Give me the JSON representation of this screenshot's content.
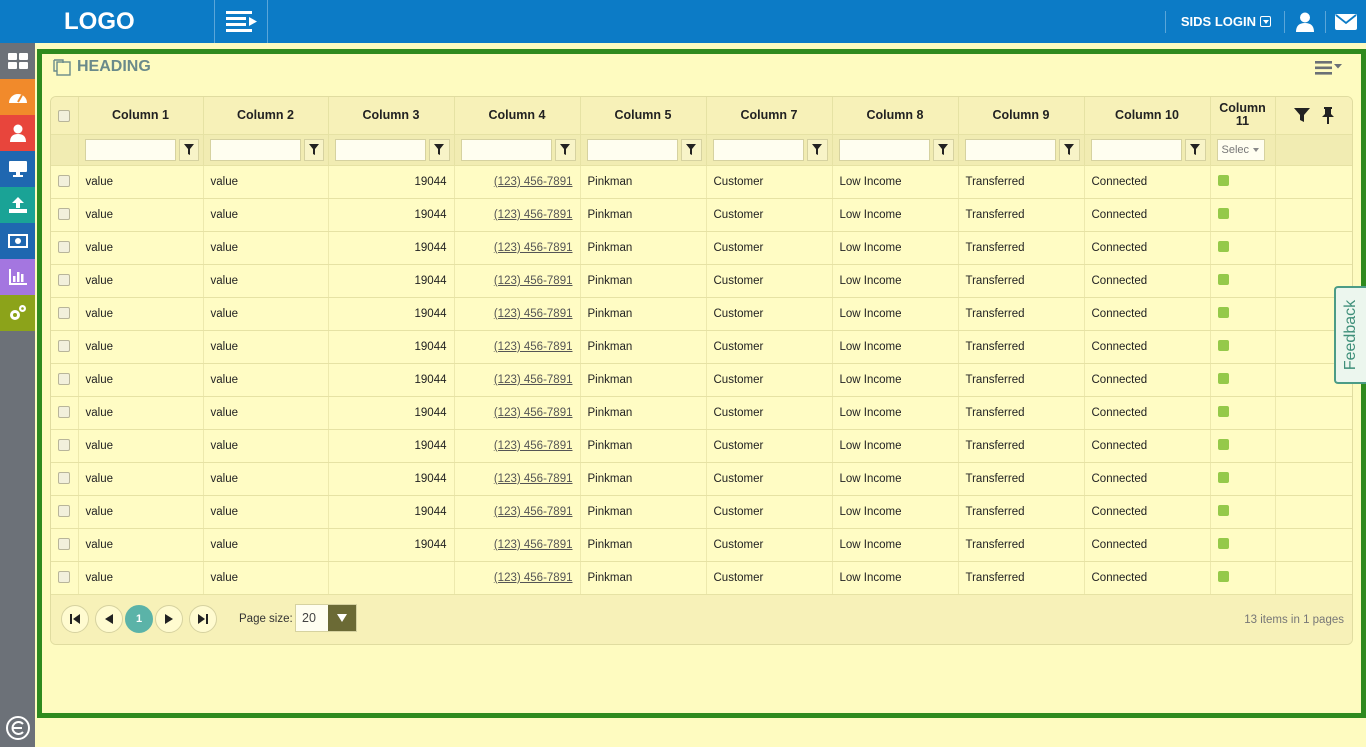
{
  "header": {
    "logo": "LOGO",
    "sids_login": "SIDS LOGIN"
  },
  "sidebar": {
    "items": [
      {
        "icon": "dashboard-grid-icon",
        "color": "#6c7178"
      },
      {
        "icon": "speedometer-icon",
        "color": "#f18a2b"
      },
      {
        "icon": "user-icon",
        "color": "#e8453c"
      },
      {
        "icon": "monitor-icon",
        "color": "#1f67b0"
      },
      {
        "icon": "upload-icon",
        "color": "#1aa396"
      },
      {
        "icon": "money-icon",
        "color": "#1f67b0"
      },
      {
        "icon": "bar-chart-icon",
        "color": "#a476e0"
      },
      {
        "icon": "settings-icon",
        "color": "#8ca31a"
      }
    ]
  },
  "panel": {
    "heading": "HEADING"
  },
  "grid": {
    "columns": [
      "Column 1",
      "Column 2",
      "Column 3",
      "Column 4",
      "Column 5",
      "Column 7",
      "Column 8",
      "Column 9",
      "Column 10",
      "Column 11"
    ],
    "filter_select_placeholder": "Selec",
    "rows": [
      {
        "c1": "value",
        "c2": "value",
        "c3": "19044",
        "c4": "(123) 456-7891",
        "c5": "Pinkman",
        "c7": "Customer",
        "c8": "Low Income",
        "c9": "Transferred",
        "c10": "Connected"
      },
      {
        "c1": "value",
        "c2": "value",
        "c3": "19044",
        "c4": "(123) 456-7891",
        "c5": "Pinkman",
        "c7": "Customer",
        "c8": "Low Income",
        "c9": "Transferred",
        "c10": "Connected"
      },
      {
        "c1": "value",
        "c2": "value",
        "c3": "19044",
        "c4": "(123) 456-7891",
        "c5": "Pinkman",
        "c7": "Customer",
        "c8": "Low Income",
        "c9": "Transferred",
        "c10": "Connected"
      },
      {
        "c1": "value",
        "c2": "value",
        "c3": "19044",
        "c4": "(123) 456-7891",
        "c5": "Pinkman",
        "c7": "Customer",
        "c8": "Low Income",
        "c9": "Transferred",
        "c10": "Connected"
      },
      {
        "c1": "value",
        "c2": "value",
        "c3": "19044",
        "c4": "(123) 456-7891",
        "c5": "Pinkman",
        "c7": "Customer",
        "c8": "Low Income",
        "c9": "Transferred",
        "c10": "Connected"
      },
      {
        "c1": "value",
        "c2": "value",
        "c3": "19044",
        "c4": "(123) 456-7891",
        "c5": "Pinkman",
        "c7": "Customer",
        "c8": "Low Income",
        "c9": "Transferred",
        "c10": "Connected"
      },
      {
        "c1": "value",
        "c2": "value",
        "c3": "19044",
        "c4": "(123) 456-7891",
        "c5": "Pinkman",
        "c7": "Customer",
        "c8": "Low Income",
        "c9": "Transferred",
        "c10": "Connected"
      },
      {
        "c1": "value",
        "c2": "value",
        "c3": "19044",
        "c4": "(123) 456-7891",
        "c5": "Pinkman",
        "c7": "Customer",
        "c8": "Low Income",
        "c9": "Transferred",
        "c10": "Connected"
      },
      {
        "c1": "value",
        "c2": "value",
        "c3": "19044",
        "c4": "(123) 456-7891",
        "c5": "Pinkman",
        "c7": "Customer",
        "c8": "Low Income",
        "c9": "Transferred",
        "c10": "Connected"
      },
      {
        "c1": "value",
        "c2": "value",
        "c3": "19044",
        "c4": "(123) 456-7891",
        "c5": "Pinkman",
        "c7": "Customer",
        "c8": "Low Income",
        "c9": "Transferred",
        "c10": "Connected"
      },
      {
        "c1": "value",
        "c2": "value",
        "c3": "19044",
        "c4": "(123) 456-7891",
        "c5": "Pinkman",
        "c7": "Customer",
        "c8": "Low Income",
        "c9": "Transferred",
        "c10": "Connected"
      },
      {
        "c1": "value",
        "c2": "value",
        "c3": "19044",
        "c4": "(123) 456-7891",
        "c5": "Pinkman",
        "c7": "Customer",
        "c8": "Low Income",
        "c9": "Transferred",
        "c10": "Connected"
      },
      {
        "c1": "value",
        "c2": "value",
        "c3": "",
        "c4": "(123) 456-7891",
        "c5": "Pinkman",
        "c7": "Customer",
        "c8": "Low Income",
        "c9": "Transferred",
        "c10": "Connected"
      }
    ]
  },
  "pager": {
    "current_page": "1",
    "page_size_label": "Page size:",
    "page_size": "20",
    "info": "13 items in 1 pages"
  },
  "feedback": "Feedback",
  "colors": {
    "topbar": "#0c7bc6",
    "frame_border": "#2f8a1e",
    "background": "#fefbc0",
    "active_page": "#5bb3a8",
    "status_green": "#95c94a"
  }
}
